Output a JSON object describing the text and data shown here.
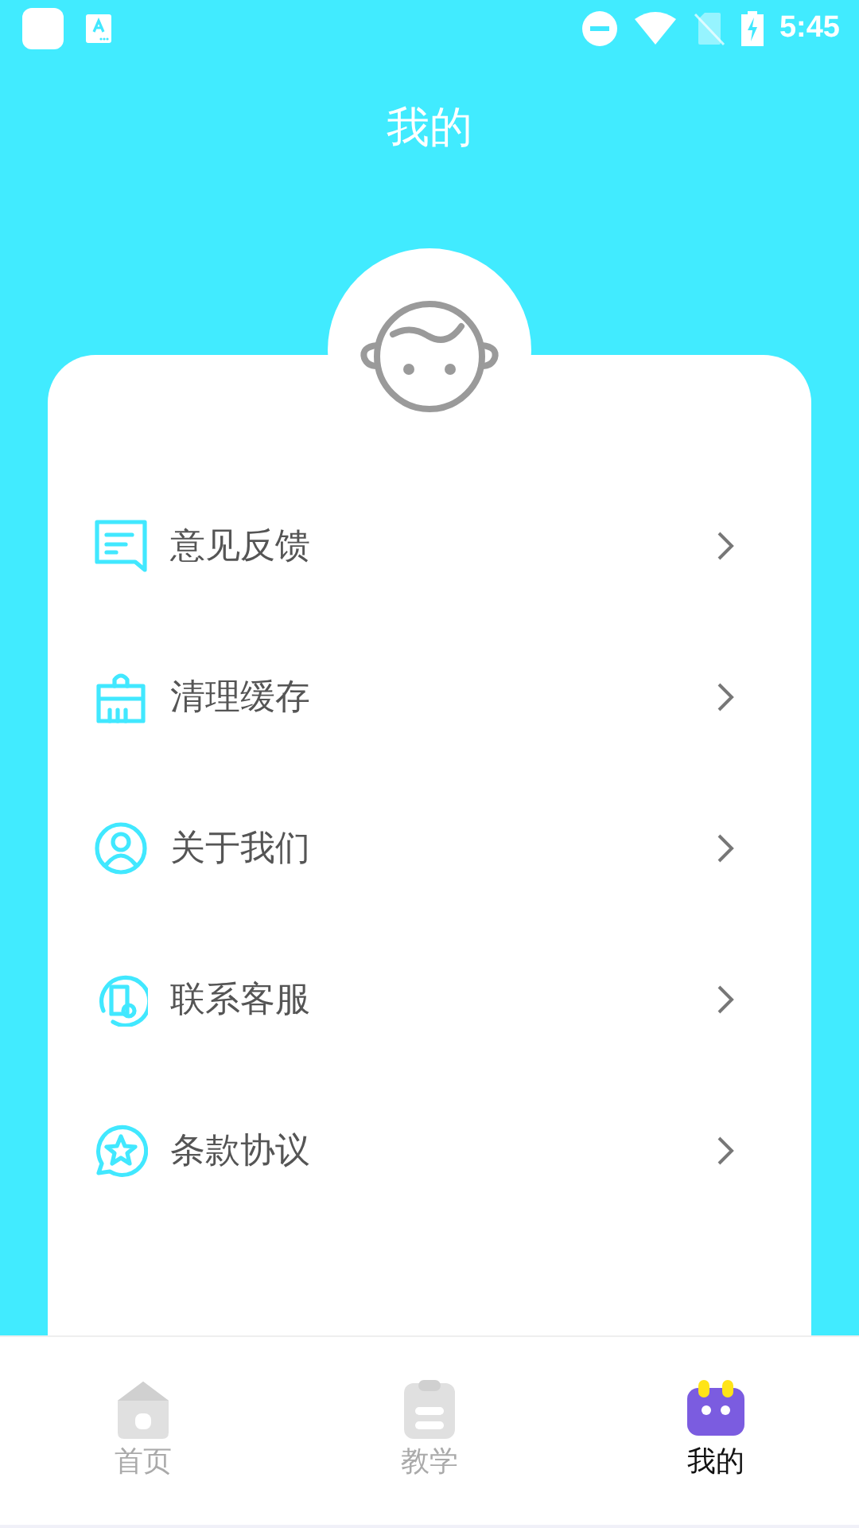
{
  "status_bar": {
    "time": "5:45"
  },
  "header": {
    "title": "我的"
  },
  "menu": [
    {
      "label": "意见反馈",
      "kind": "feedback"
    },
    {
      "label": "清理缓存",
      "kind": "clean"
    },
    {
      "label": "关于我们",
      "kind": "about"
    },
    {
      "label": "联系客服",
      "kind": "service"
    },
    {
      "label": "条款协议",
      "kind": "terms"
    }
  ],
  "tabs": [
    {
      "label": "首页",
      "kind": "home",
      "selected": false
    },
    {
      "label": "教学",
      "kind": "teach",
      "selected": false
    },
    {
      "label": "我的",
      "kind": "mine",
      "selected": true
    }
  ]
}
